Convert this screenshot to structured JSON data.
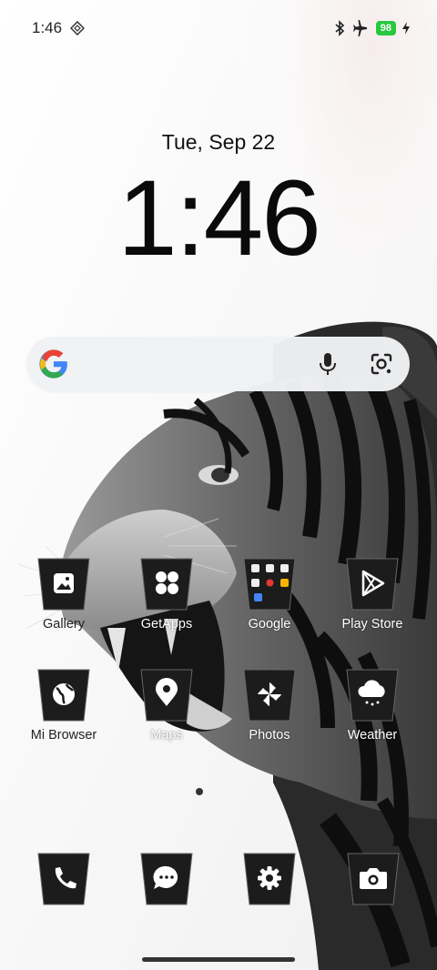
{
  "status_bar": {
    "time": "1:46",
    "battery": "98",
    "icons": [
      "diamond-grid-icon",
      "bluetooth-icon",
      "airplane-icon",
      "battery-icon",
      "charging-bolt-icon"
    ]
  },
  "clock": {
    "date": "Tue, Sep 22",
    "time": "1:46"
  },
  "search": {
    "icons": [
      "google-logo-icon",
      "microphone-icon",
      "google-lens-icon"
    ]
  },
  "apps": {
    "row1": [
      {
        "label": "Gallery",
        "icon": "gallery-icon"
      },
      {
        "label": "GetApps",
        "icon": "getapps-icon"
      },
      {
        "label": "Google",
        "icon": "google-folder-icon"
      },
      {
        "label": "Play Store",
        "icon": "play-store-icon"
      }
    ],
    "row2": [
      {
        "label": "Mi Browser",
        "icon": "globe-icon"
      },
      {
        "label": "Maps",
        "icon": "maps-pin-icon"
      },
      {
        "label": "Photos",
        "icon": "pinwheel-icon"
      },
      {
        "label": "Weather",
        "icon": "weather-cloud-icon"
      }
    ]
  },
  "dock": [
    {
      "icon": "phone-icon"
    },
    {
      "icon": "messages-icon"
    },
    {
      "icon": "settings-gear-icon"
    },
    {
      "icon": "camera-icon"
    }
  ],
  "colors": {
    "battery": "#27c93f",
    "icon_tile": "#1c1c1c",
    "background": "#f7f7f7"
  }
}
